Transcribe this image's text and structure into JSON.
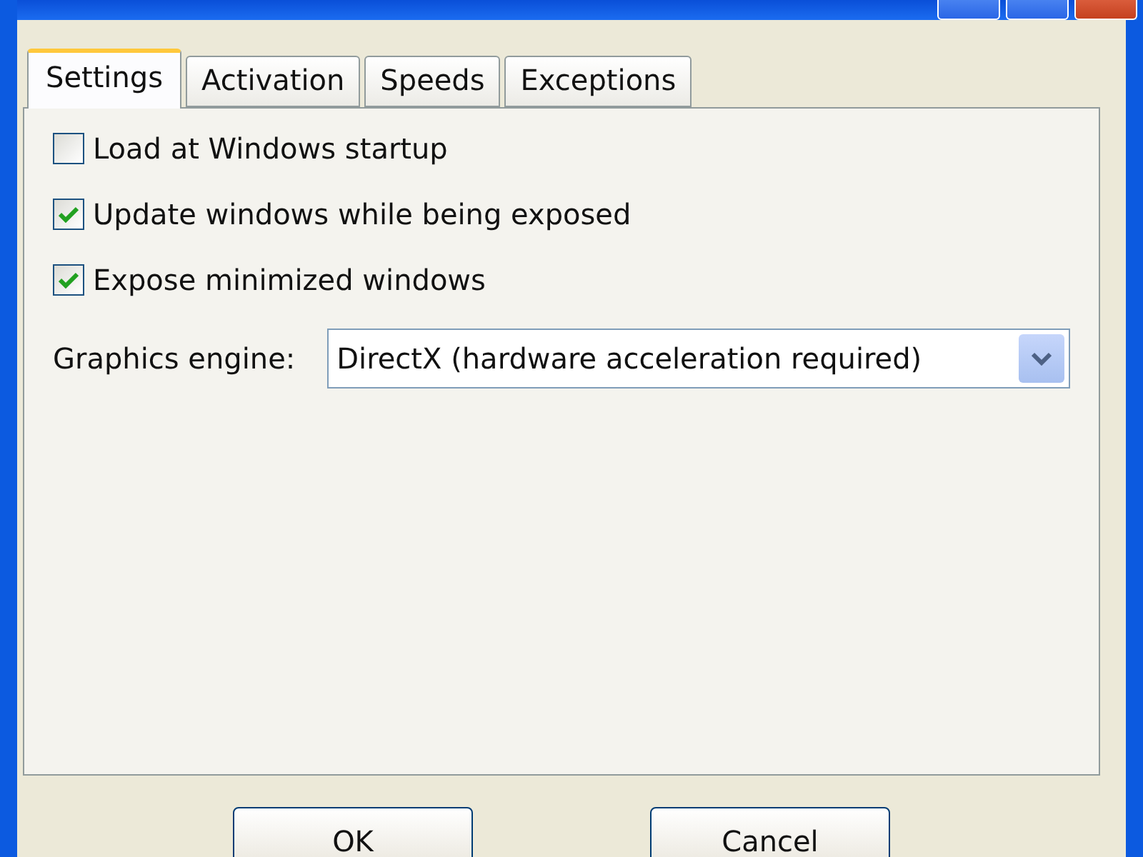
{
  "tabs": [
    {
      "label": "Settings",
      "selected": true
    },
    {
      "label": "Activation",
      "selected": false
    },
    {
      "label": "Speeds",
      "selected": false
    },
    {
      "label": "Exceptions",
      "selected": false
    }
  ],
  "options": [
    {
      "label": "Load at Windows startup",
      "checked": false
    },
    {
      "label": "Update windows while being exposed",
      "checked": true
    },
    {
      "label": "Expose minimized windows",
      "checked": true
    }
  ],
  "graphics_engine": {
    "label": "Graphics engine:",
    "value": "DirectX (hardware acceleration required)"
  },
  "buttons": [
    "OK",
    "Cancel"
  ]
}
